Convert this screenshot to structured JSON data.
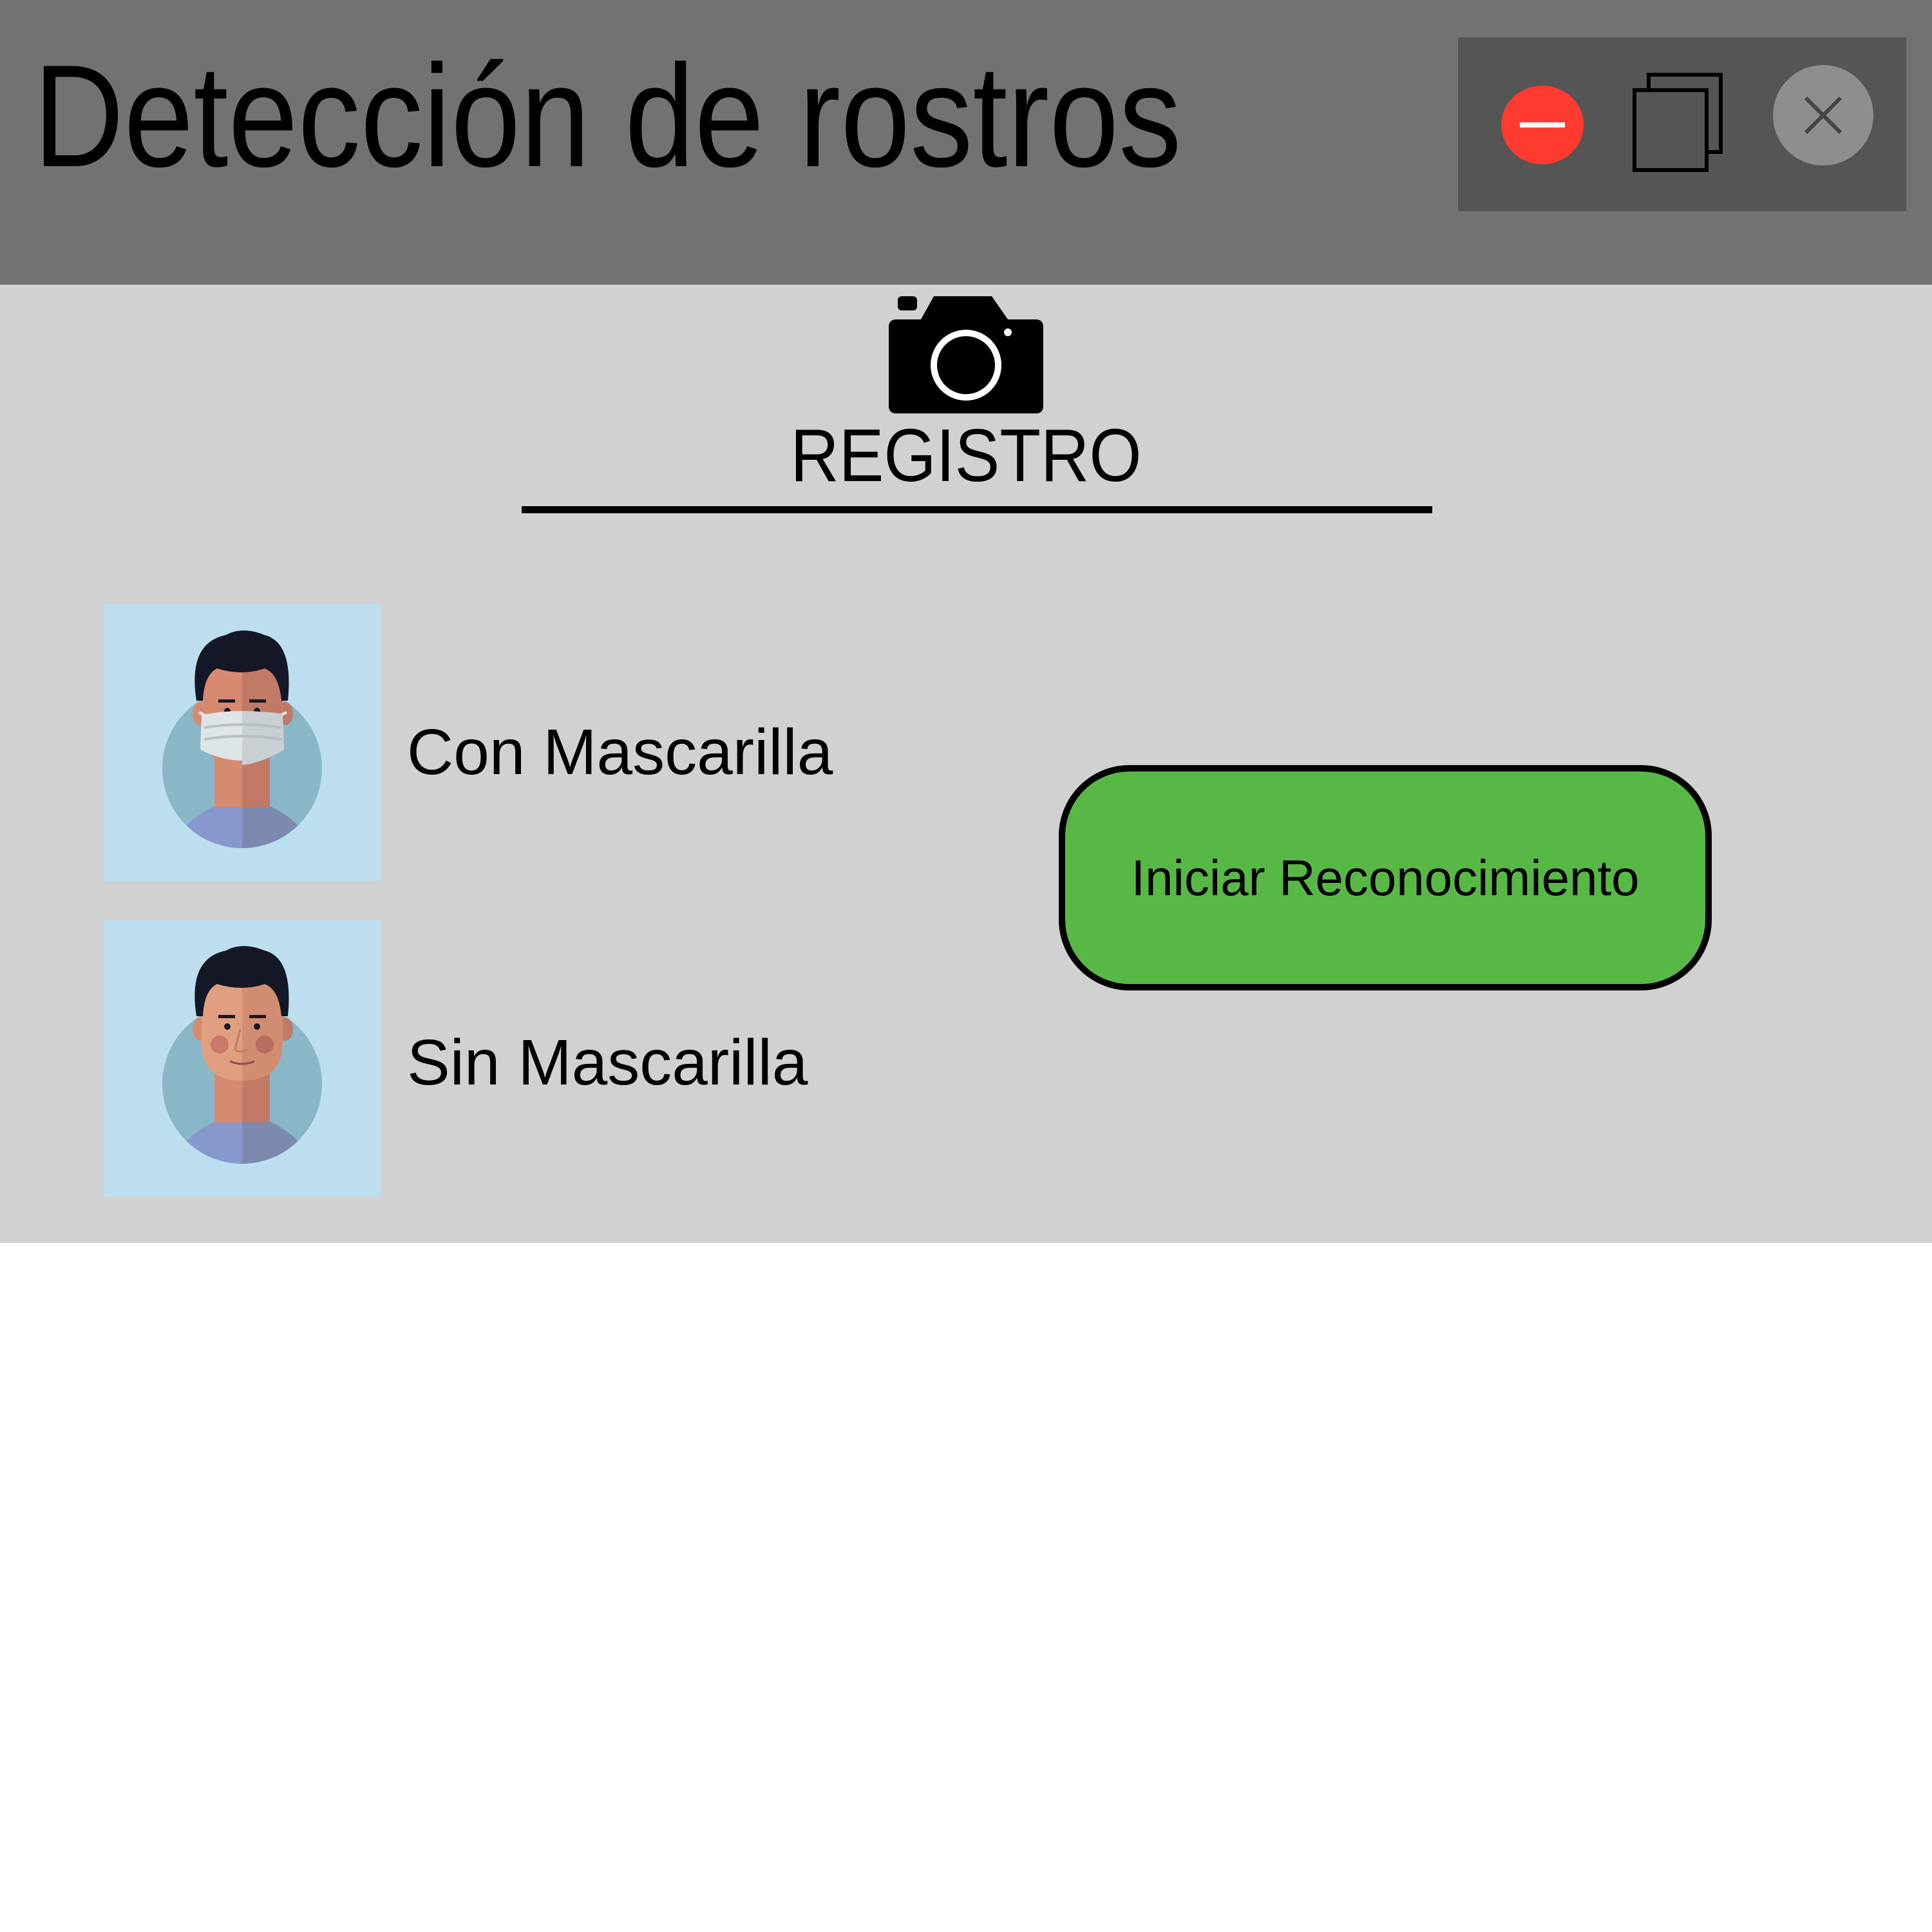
{
  "window": {
    "title": "Detección de rostros",
    "controls": {
      "minimize_icon": "minimize-icon",
      "restore_icon": "restore-icon",
      "close_icon": "close-icon"
    }
  },
  "main": {
    "camera_icon": "camera-icon",
    "section_title": "REGISTRO",
    "options": [
      {
        "label": "Con Mascarilla",
        "avatar": "masked-person-avatar"
      },
      {
        "label": "Sin Mascarilla",
        "avatar": "unmasked-person-avatar"
      }
    ],
    "start_button_label": "Iniciar Reconocimiento"
  },
  "colors": {
    "titlebar": "#727272",
    "controls_panel": "#555555",
    "content_bg": "#d1d1d1",
    "minimize": "#ff3b30",
    "close": "#8e8e8e",
    "button_green": "#58b845",
    "avatar_bg": "#bddeee"
  }
}
